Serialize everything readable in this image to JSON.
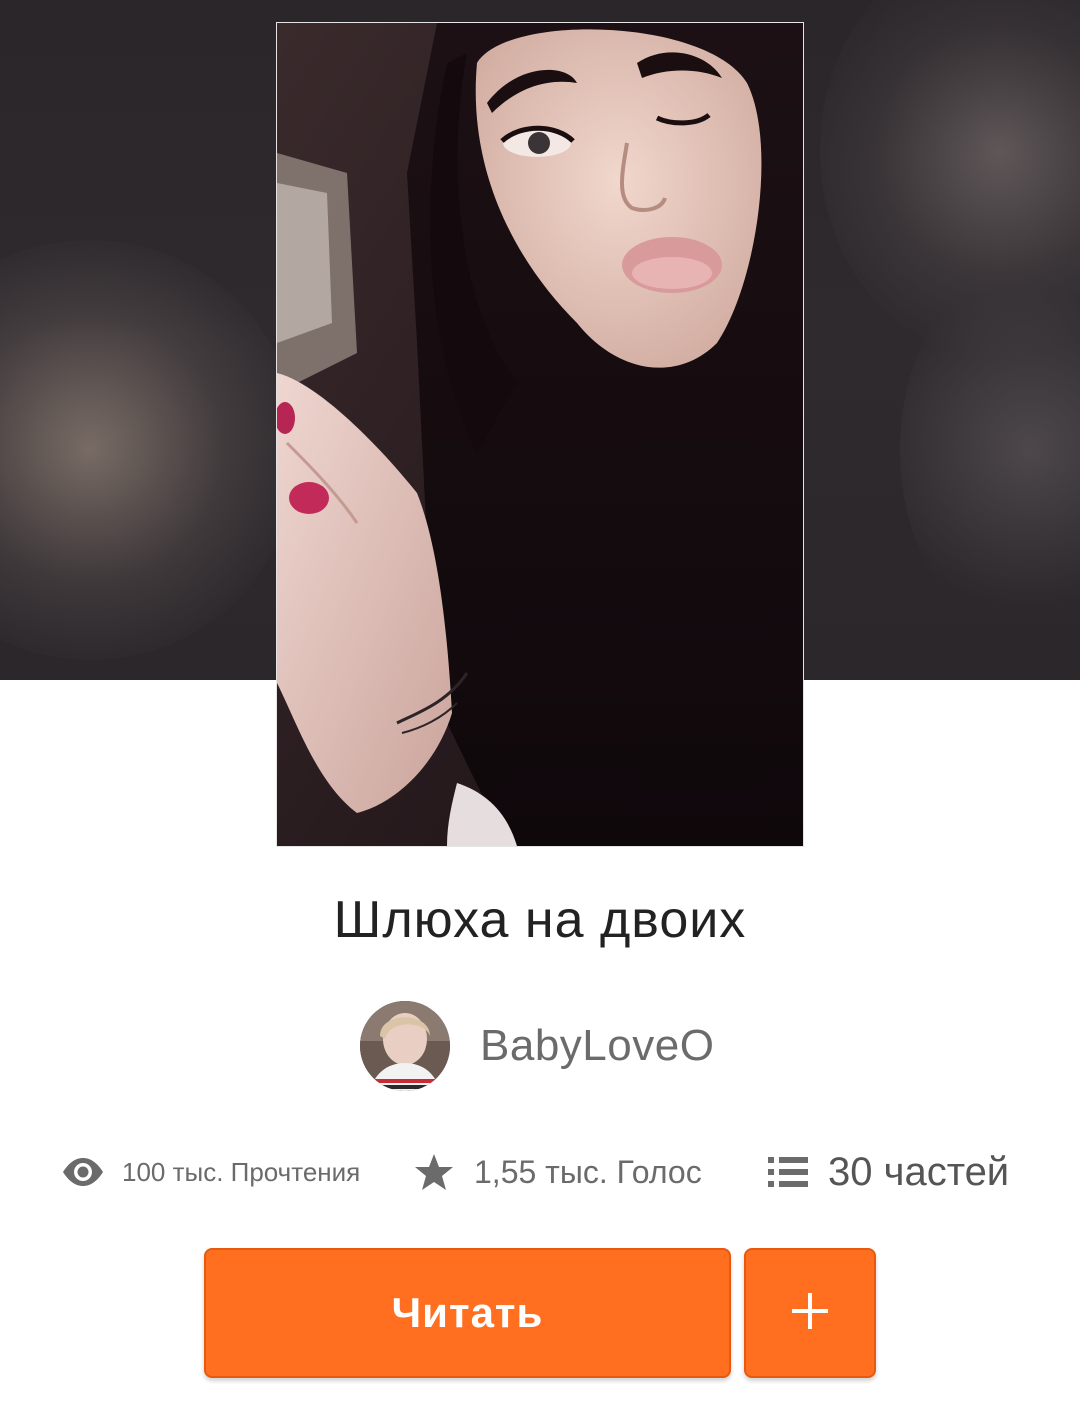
{
  "story": {
    "title": "Шлюха на двоих",
    "author": "BabyLoveO"
  },
  "stats": {
    "reads": "100 тыс. Прочтения",
    "votes": "1,55 тыс. Голос",
    "parts": "30 частей"
  },
  "actions": {
    "read_label": "Читать",
    "add_label": "+"
  },
  "icons": {
    "reads": "eye-icon",
    "votes": "star-icon",
    "parts": "list-icon",
    "add": "plus-icon"
  },
  "colors": {
    "accent": "#ff6f1f",
    "accent_border": "#e65a10",
    "text_primary": "#222222",
    "text_secondary": "#6b6b6b",
    "backdrop": "#2e2a2e"
  }
}
